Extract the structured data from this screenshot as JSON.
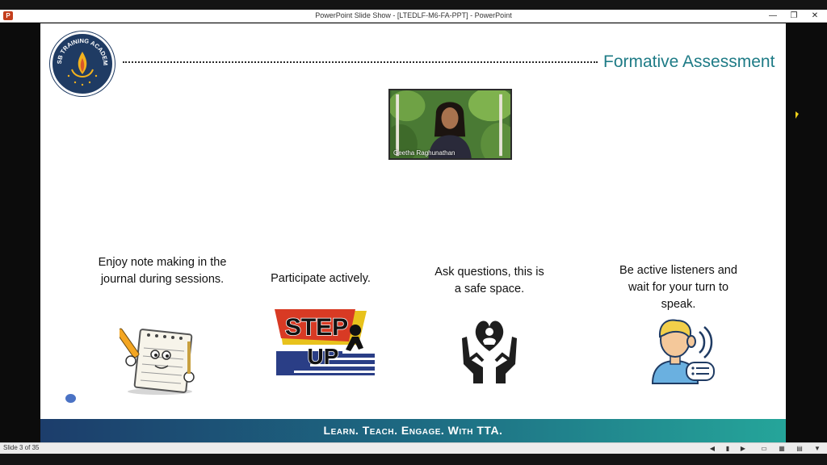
{
  "window": {
    "title": "PowerPoint Slide Show - [LTEDLF-M6-FA-PPT] - PowerPoint",
    "app_icon": "P",
    "controls": {
      "minimize": "—",
      "restore": "❐",
      "close": "✕"
    }
  },
  "slide": {
    "heading": "Formative Assessment",
    "logo_text": "TISB TRAINING ACADEMY",
    "video": {
      "participant_name": "Geetha Raghunathan"
    },
    "items": [
      {
        "caption": "Enjoy note making in the journal during sessions.",
        "icon": "notepad-pencil-icon"
      },
      {
        "caption": "Participate actively.",
        "icon": "step-up-icon"
      },
      {
        "caption": "Ask questions, this is a safe space.",
        "icon": "hands-heart-icon"
      },
      {
        "caption": "Be active listeners and wait for your turn to speak.",
        "icon": "listener-icon"
      }
    ],
    "step_up_text": {
      "line1": "STEP",
      "line2": "UP"
    },
    "footer": "Learn. Teach. Engage. With TTA."
  },
  "statusbar": {
    "slide_counter": "Slide 3 of 35",
    "buttons": [
      "◀",
      "▮",
      "▶",
      "▭",
      "▦",
      "▤",
      "▼"
    ]
  },
  "colors": {
    "heading": "#1e7b86",
    "footer_start": "#1c3d6b",
    "footer_end": "#25a59a",
    "logo_bg": "#1f3b63"
  }
}
